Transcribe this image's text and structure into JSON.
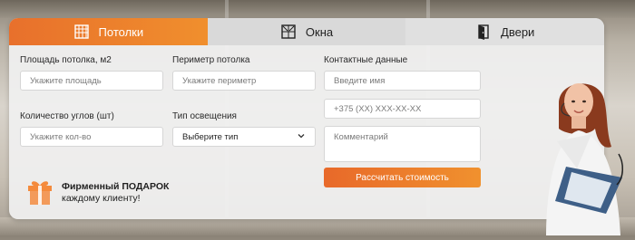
{
  "tabs": [
    {
      "label": "Потолки",
      "icon": "ceiling-icon",
      "active": true
    },
    {
      "label": "Окна",
      "icon": "window-icon",
      "active": false
    },
    {
      "label": "Двери",
      "icon": "door-icon",
      "active": false
    }
  ],
  "form": {
    "area_label": "Площадь потолка, м2",
    "area_placeholder": "Укажите площадь",
    "perimeter_label": "Периметр потолка",
    "perimeter_placeholder": "Укажите периметр",
    "contacts_label": "Контактные данные",
    "name_placeholder": "Введите имя",
    "phone_placeholder": "+375 (XX) XXX-XX-XX",
    "corners_label": "Количество углов (шт)",
    "corners_placeholder": "Укажите кол-во",
    "lighting_label": "Тип освещения",
    "lighting_selected": "Выберите тип",
    "comment_placeholder": "Комментарий",
    "submit_label": "Рассчитать стоимость"
  },
  "gift": {
    "line1": "Фирменный ПОДАРОК",
    "line2": "каждому клиенту!"
  },
  "colors": {
    "accent_start": "#e8692a",
    "accent_end": "#f0912e",
    "panel_bg": "#f0f0f0"
  }
}
